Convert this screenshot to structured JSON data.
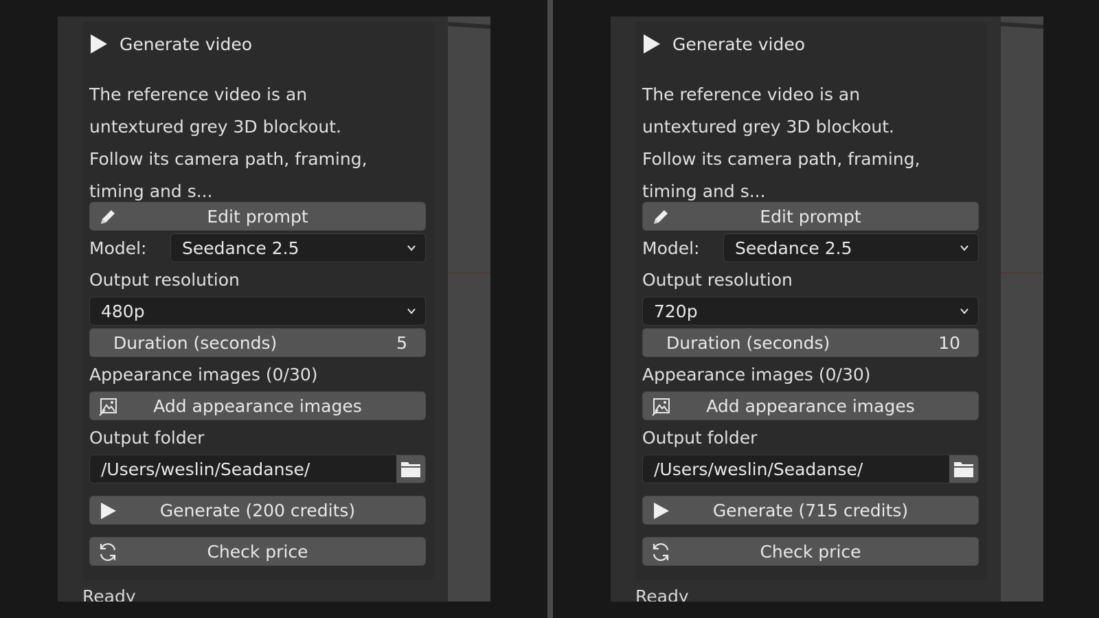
{
  "panels": [
    {
      "title": "Generate video",
      "description": [
        "The reference video is an",
        "untextured grey 3D blockout.",
        "Follow its camera path, framing,",
        "timing and s..."
      ],
      "edit_prompt_label": "Edit prompt",
      "model_label": "Model:",
      "model_value": "Seedance 2.5",
      "resolution_label": "Output resolution",
      "resolution_value": "480p",
      "duration_label": "Duration (seconds)",
      "duration_value": "5",
      "appearance_label": "Appearance images (0/30)",
      "add_images_label": "Add appearance images",
      "output_folder_label": "Output folder",
      "output_folder_value": "/Users/weslin/Seadanse/",
      "generate_label": "Generate (200 credits)",
      "check_price_label": "Check price",
      "status": "Ready"
    },
    {
      "title": "Generate video",
      "description": [
        "The reference video is an",
        "untextured grey 3D blockout.",
        "Follow its camera path, framing,",
        "timing and s..."
      ],
      "edit_prompt_label": "Edit prompt",
      "model_label": "Model:",
      "model_value": "Seedance 2.5",
      "resolution_label": "Output resolution",
      "resolution_value": "720p",
      "duration_label": "Duration (seconds)",
      "duration_value": "10",
      "appearance_label": "Appearance images (0/30)",
      "add_images_label": "Add appearance images",
      "output_folder_label": "Output folder",
      "output_folder_value": "/Users/weslin/Seadanse/",
      "generate_label": "Generate (715 credits)",
      "check_price_label": "Check price",
      "status": "Ready"
    }
  ],
  "icons": {
    "title": "play-icon",
    "edit": "pencil-icon",
    "add_images": "image-add-icon",
    "folder": "folder-icon",
    "generate": "play-icon",
    "check_price": "refresh-icon",
    "dropdown": "chevron-down-icon"
  },
  "colors": {
    "background": "#181818",
    "panel": "#2b2b2b",
    "button": "#545454",
    "input": "#1f1f1f",
    "text": "#e8e8e8"
  }
}
